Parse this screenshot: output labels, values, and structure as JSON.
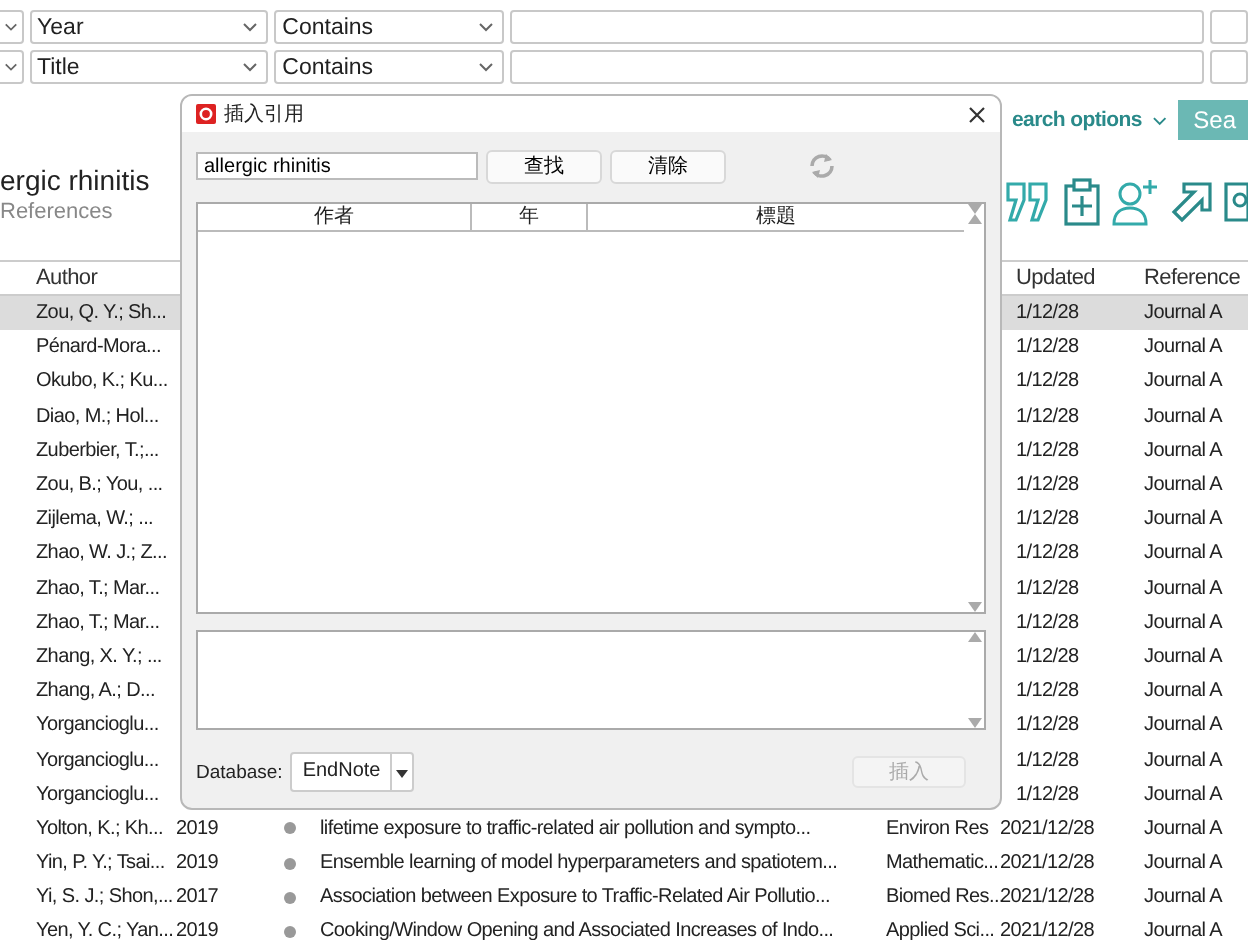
{
  "filters": [
    {
      "field": "Year",
      "operator": "Contains"
    },
    {
      "field": "Title",
      "operator": "Contains"
    }
  ],
  "library": {
    "heading": "ergic rhinitis",
    "subheading": "References",
    "search_options": "earch options",
    "search_button": "Sea"
  },
  "table": {
    "columns": [
      "Author",
      "Updated",
      "Reference"
    ],
    "rows": [
      {
        "author": "Zou, Q. Y.; Sh...",
        "updated": "1/12/28",
        "type": "Journal A",
        "selected": true
      },
      {
        "author": "Pénard-Mora...",
        "updated": "1/12/28",
        "type": "Journal A",
        "selected": false
      },
      {
        "author": "Okubo, K.; Ku...",
        "updated": "1/12/28",
        "type": "Journal A",
        "selected": false
      },
      {
        "author": "Diao, M.; Hol...",
        "updated": "1/12/28",
        "type": "Journal A",
        "selected": false
      },
      {
        "author": "Zuberbier, T.;...",
        "updated": "1/12/28",
        "type": "Journal A",
        "selected": false
      },
      {
        "author": "Zou, B.; You, ...",
        "updated": "1/12/28",
        "type": "Journal A",
        "selected": false
      },
      {
        "author": "Zijlema, W.; ...",
        "updated": "1/12/28",
        "type": "Journal A",
        "selected": false
      },
      {
        "author": "Zhao, W. J.; Z...",
        "updated": "1/12/28",
        "type": "Journal A",
        "selected": false
      },
      {
        "author": "Zhao, T.; Mar...",
        "updated": "1/12/28",
        "type": "Journal A",
        "selected": false
      },
      {
        "author": "Zhao, T.; Mar...",
        "updated": "1/12/28",
        "type": "Journal A",
        "selected": false
      },
      {
        "author": "Zhang, X. Y.; ...",
        "updated": "1/12/28",
        "type": "Journal A",
        "selected": false
      },
      {
        "author": "Zhang, A.; D...",
        "updated": "1/12/28",
        "type": "Journal A",
        "selected": false
      },
      {
        "author": "Yorgancioglu...",
        "updated": "1/12/28",
        "type": "Journal A",
        "selected": false
      },
      {
        "author": "Yorgancioglu...",
        "updated": "1/12/28",
        "type": "Journal A",
        "selected": false
      },
      {
        "author": "Yorgancioglu...",
        "updated": "1/12/28",
        "type": "Journal A",
        "selected": false
      },
      {
        "author": "Yolton, K.; Kh...",
        "year": "2019",
        "title": "lifetime exposure to traffic-related air pollution and sympto...",
        "journal": "Environ Res",
        "updated": "2021/12/28",
        "type": "Journal A",
        "selected": false
      },
      {
        "author": "Yin, P. Y.; Tsai...",
        "year": "2019",
        "title": "Ensemble learning of model hyperparameters and spatiotem...",
        "journal": "Mathematic...",
        "updated": "2021/12/28",
        "type": "Journal A",
        "selected": false
      },
      {
        "author": "Yi, S. J.; Shon,...",
        "year": "2017",
        "title": "Association between Exposure to Traffic-Related Air Pollutio...",
        "journal": "Biomed Res...",
        "updated": "2021/12/28",
        "type": "Journal A",
        "selected": false
      },
      {
        "author": "Yen, Y. C.; Yan...",
        "year": "2019",
        "title": "Cooking/Window Opening and Associated Increases of Indo...",
        "journal": "Applied Sci...",
        "updated": "2021/12/28",
        "type": "Journal A",
        "selected": false
      }
    ]
  },
  "dialog": {
    "title": "插入引用",
    "search_value": "allergic rhinitis",
    "find_button": "查找",
    "clear_button": "清除",
    "columns": [
      "作者",
      "年",
      "標題"
    ],
    "database_label": "Database:",
    "database": "EndNote",
    "insert_button": {
      "label": "插入",
      "disabled": true
    }
  }
}
